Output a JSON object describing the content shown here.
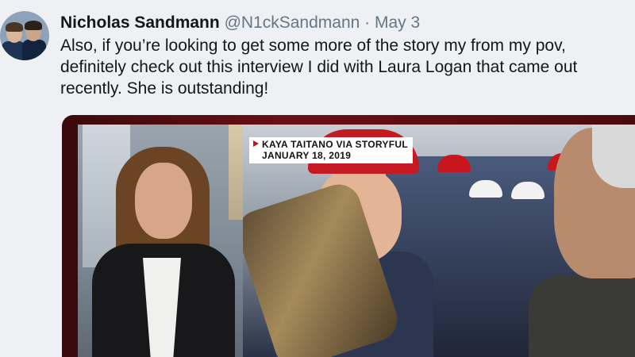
{
  "tweet": {
    "author_name": "Nicholas Sandmann",
    "handle": "@N1ckSandmann",
    "separator": "·",
    "date": "May 3",
    "text": "Also, if you’re looking to get some more of the story my from my pov, definitely check out this interview I did with Laura Logan that came out recently. She is outstanding!"
  },
  "media": {
    "caption_line1": "KAYA TAITANO VIA STORYFUL",
    "caption_line2": "JANUARY 18, 2019"
  },
  "colors": {
    "name_text": "#14171a",
    "secondary_text": "#657786",
    "caption_marker": "#c0161d"
  }
}
